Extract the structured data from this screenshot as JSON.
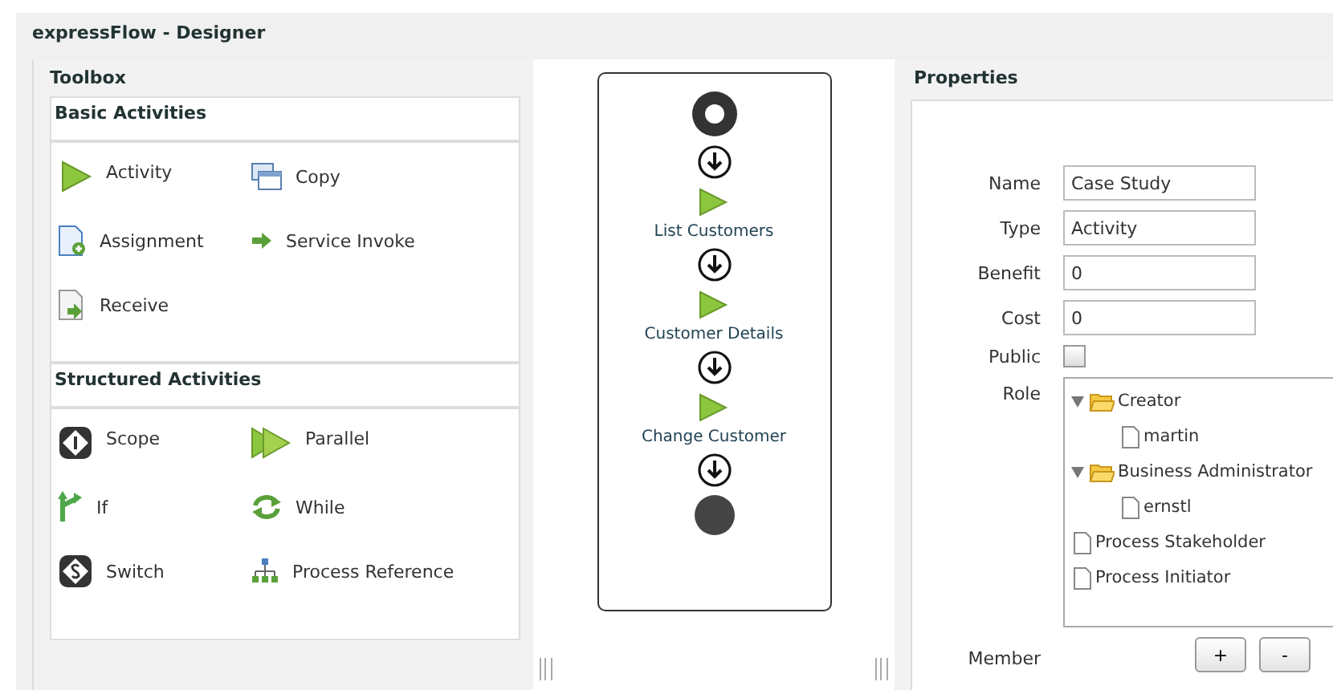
{
  "window": {
    "title": "expressFlow - Designer"
  },
  "toolbox": {
    "title": "Toolbox",
    "sections": [
      {
        "title": "Basic Activities",
        "items": [
          {
            "label": "Activity",
            "kind": "activity"
          },
          {
            "label": "Copy",
            "kind": "copy"
          },
          {
            "label": "Assignment",
            "kind": "assignment"
          },
          {
            "label": "Service Invoke",
            "kind": "service"
          },
          {
            "label": "Receive",
            "kind": "receive"
          }
        ]
      },
      {
        "title": "Structured Activities",
        "items": [
          {
            "label": "Scope",
            "kind": "scope"
          },
          {
            "label": "Parallel",
            "kind": "parallel"
          },
          {
            "label": "If",
            "kind": "if"
          },
          {
            "label": "While",
            "kind": "while"
          },
          {
            "label": "Switch",
            "kind": "switch"
          },
          {
            "label": "Process Reference",
            "kind": "reference"
          }
        ]
      }
    ]
  },
  "flow": {
    "nodes": [
      {
        "kind": "start"
      },
      {
        "kind": "arrow"
      },
      {
        "kind": "activity",
        "label": "List Customers"
      },
      {
        "kind": "arrow"
      },
      {
        "kind": "activity",
        "label": "Customer Details"
      },
      {
        "kind": "arrow"
      },
      {
        "kind": "activity",
        "label": "Change Customer"
      },
      {
        "kind": "arrow"
      },
      {
        "kind": "end"
      }
    ]
  },
  "properties": {
    "title": "Properties",
    "fields": [
      {
        "label": "Name",
        "value": "Case Study"
      },
      {
        "label": "Type",
        "value": "Activity"
      },
      {
        "label": "Benefit",
        "value": "0"
      },
      {
        "label": "Cost",
        "value": "0"
      }
    ],
    "public": {
      "label": "Public",
      "checked": false
    },
    "role": {
      "label": "Role",
      "tree": [
        {
          "label": "Creator",
          "kind": "folder",
          "expanded": true,
          "children": [
            {
              "label": "martin",
              "kind": "file"
            }
          ]
        },
        {
          "label": "Business Administrator",
          "kind": "folder",
          "expanded": true,
          "children": [
            {
              "label": "ernstl",
              "kind": "file"
            }
          ]
        },
        {
          "label": "Process Stakeholder",
          "kind": "file"
        },
        {
          "label": "Process Initiator",
          "kind": "file"
        }
      ]
    },
    "member": {
      "label": "Member",
      "buttons": [
        "+",
        "-"
      ]
    }
  }
}
